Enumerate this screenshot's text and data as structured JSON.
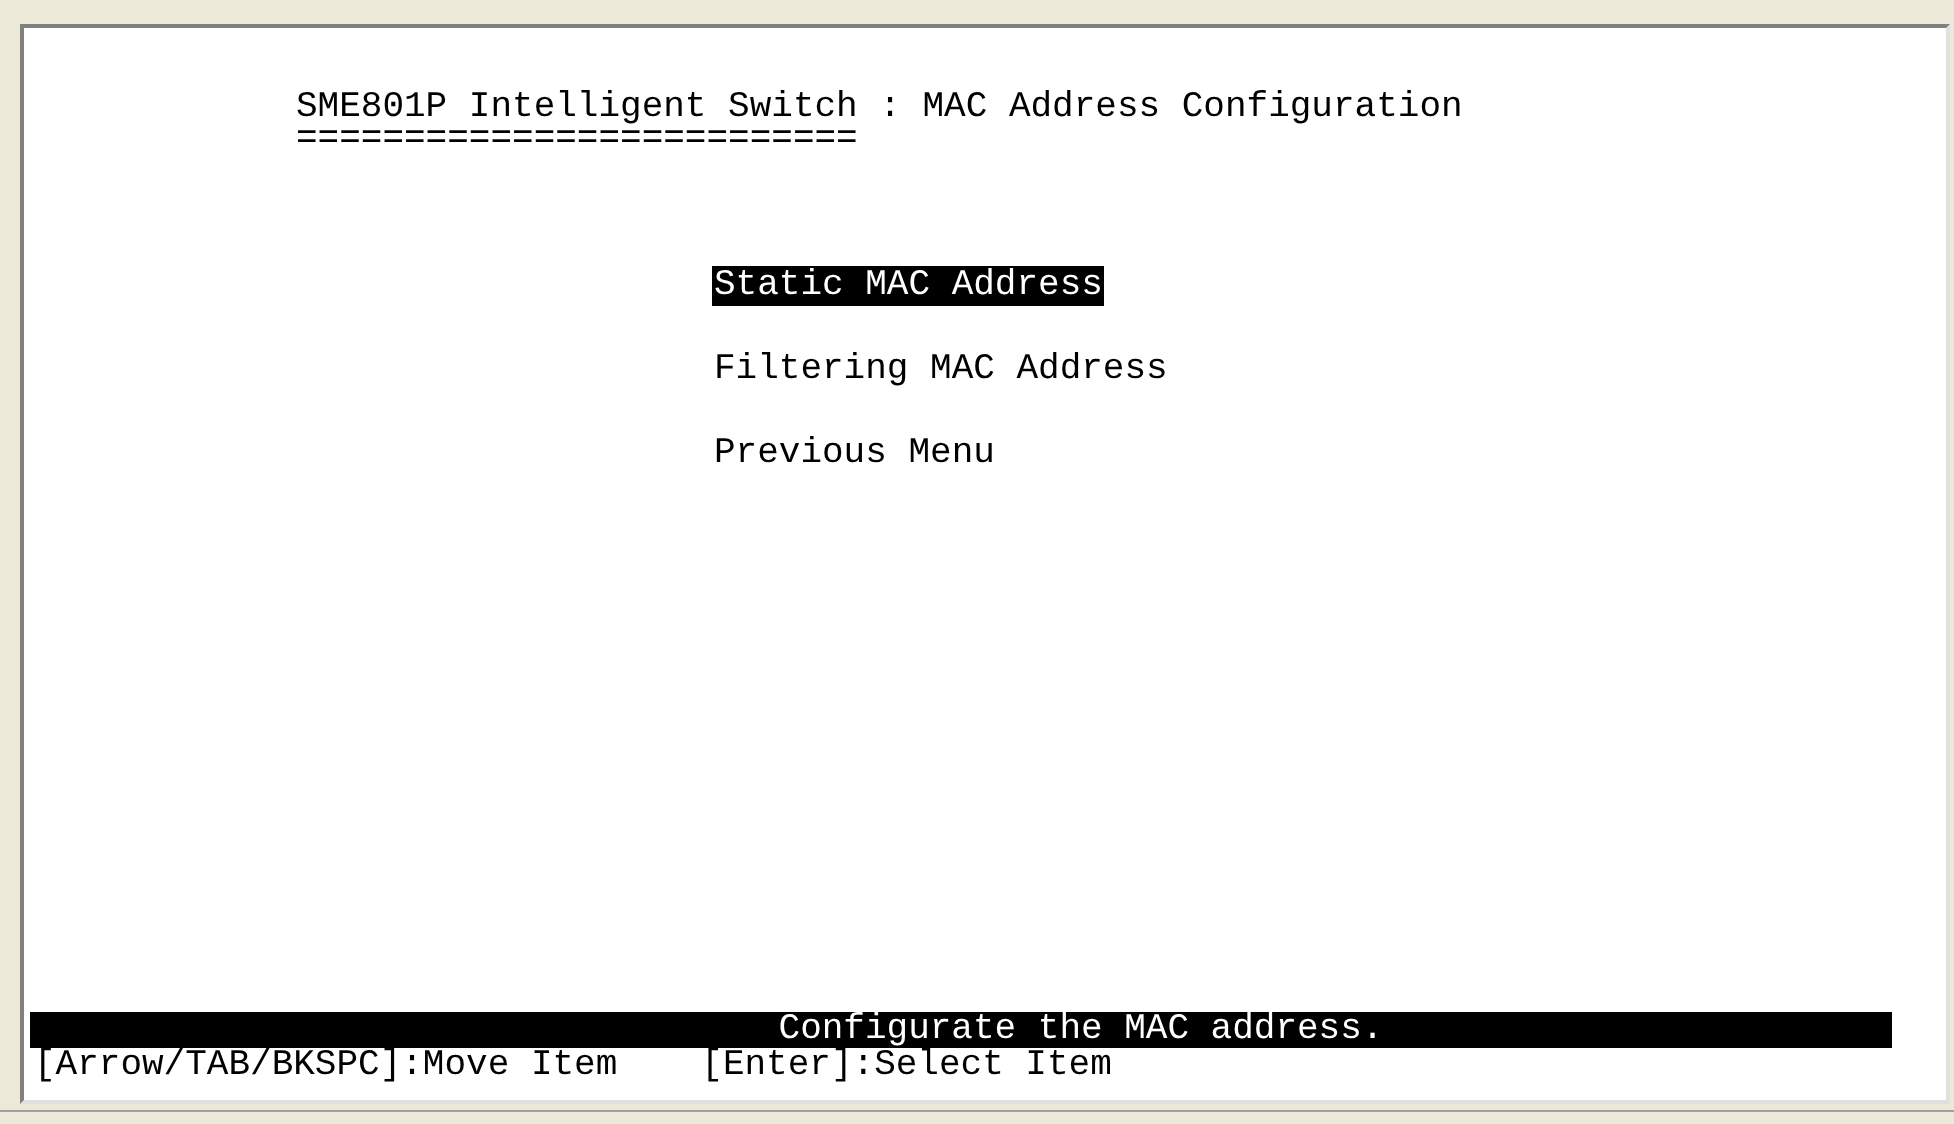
{
  "screen": {
    "title": "SME801P Intelligent Switch : MAC Address Configuration",
    "title_underline": "==========================",
    "menu_items": [
      {
        "label": "Static MAC Address",
        "selected": true
      },
      {
        "label": "Filtering MAC Address",
        "selected": false
      },
      {
        "label": "Previous Menu",
        "selected": false
      }
    ],
    "status_message": "Configurate the MAC address.",
    "help_keys": [
      "[Arrow/TAB/BKSPC]:Move Item",
      "[Enter]:Select Item"
    ]
  }
}
